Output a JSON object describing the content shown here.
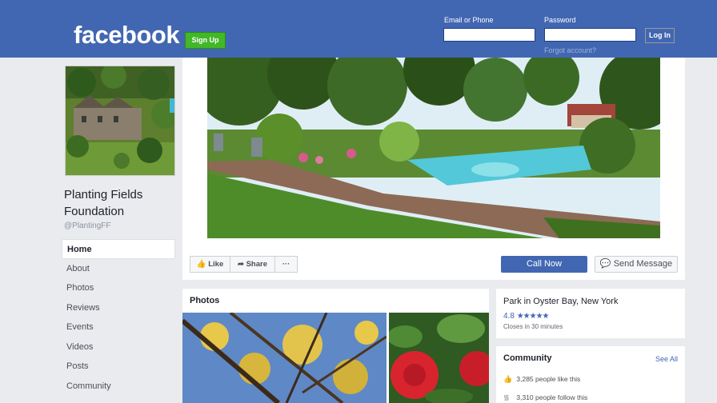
{
  "header": {
    "logo": "facebook",
    "signup_label": "Sign Up",
    "email_label": "Email or Phone",
    "password_label": "Password",
    "login_label": "Log In",
    "forgot_label": "Forgot account?",
    "brand_color": "#4267b2"
  },
  "page": {
    "name": "Planting Fields Foundation",
    "handle": "@PlantingFF"
  },
  "nav": {
    "items": [
      "Home",
      "About",
      "Photos",
      "Reviews",
      "Events",
      "Videos",
      "Posts",
      "Community"
    ],
    "active": "Home"
  },
  "actions": {
    "like": "Like",
    "share": "Share",
    "more": "···",
    "call_now": "Call Now",
    "send_message": "Send Message"
  },
  "photos": {
    "title": "Photos"
  },
  "info": {
    "category": "Park in Oyster Bay, New York",
    "rating": "4.8",
    "stars": "★★★★★",
    "hours": "Closes in 30 minutes"
  },
  "community": {
    "title": "Community",
    "see_all": "See All",
    "likes": "3,285 people like this",
    "follows": "3,310 people follow this"
  },
  "icons": {
    "like": "thumbs-up-icon",
    "share": "share-arrow-icon",
    "messenger": "messenger-icon",
    "rss": "rss-icon"
  }
}
